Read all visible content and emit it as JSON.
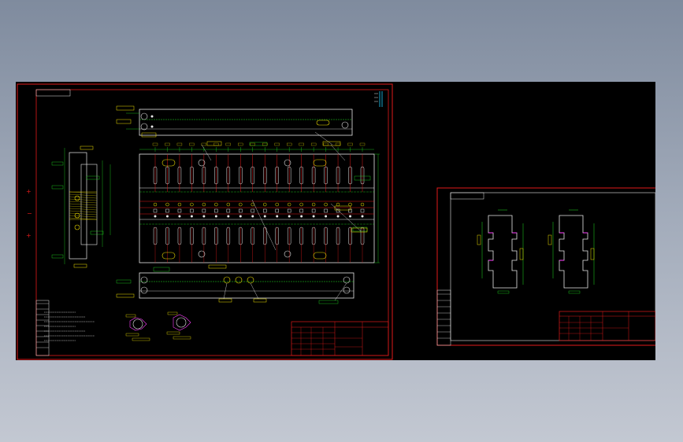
{
  "colors": {
    "background": "#000000",
    "frame": "#e01a1a",
    "line": "#ffffff",
    "dimension": "#20e020",
    "annotation": "#f0e000",
    "accent": "#20d0ff",
    "magenta": "#ff40ff"
  },
  "sheet1": {
    "title_block": {
      "name": "",
      "code": "",
      "scale": "",
      "sheet": ""
    },
    "notes": [],
    "rows": 9,
    "columns": 18,
    "icons": [
      "sheet-frame-icon",
      "mold-plate-icon",
      "pin-hole-icon",
      "dimension-line-icon",
      "title-block-icon"
    ]
  },
  "sheet2": {
    "title_block": {
      "name": "",
      "code": ""
    },
    "profile_count": 2
  },
  "side_marks": [
    "+",
    "−",
    "+"
  ]
}
